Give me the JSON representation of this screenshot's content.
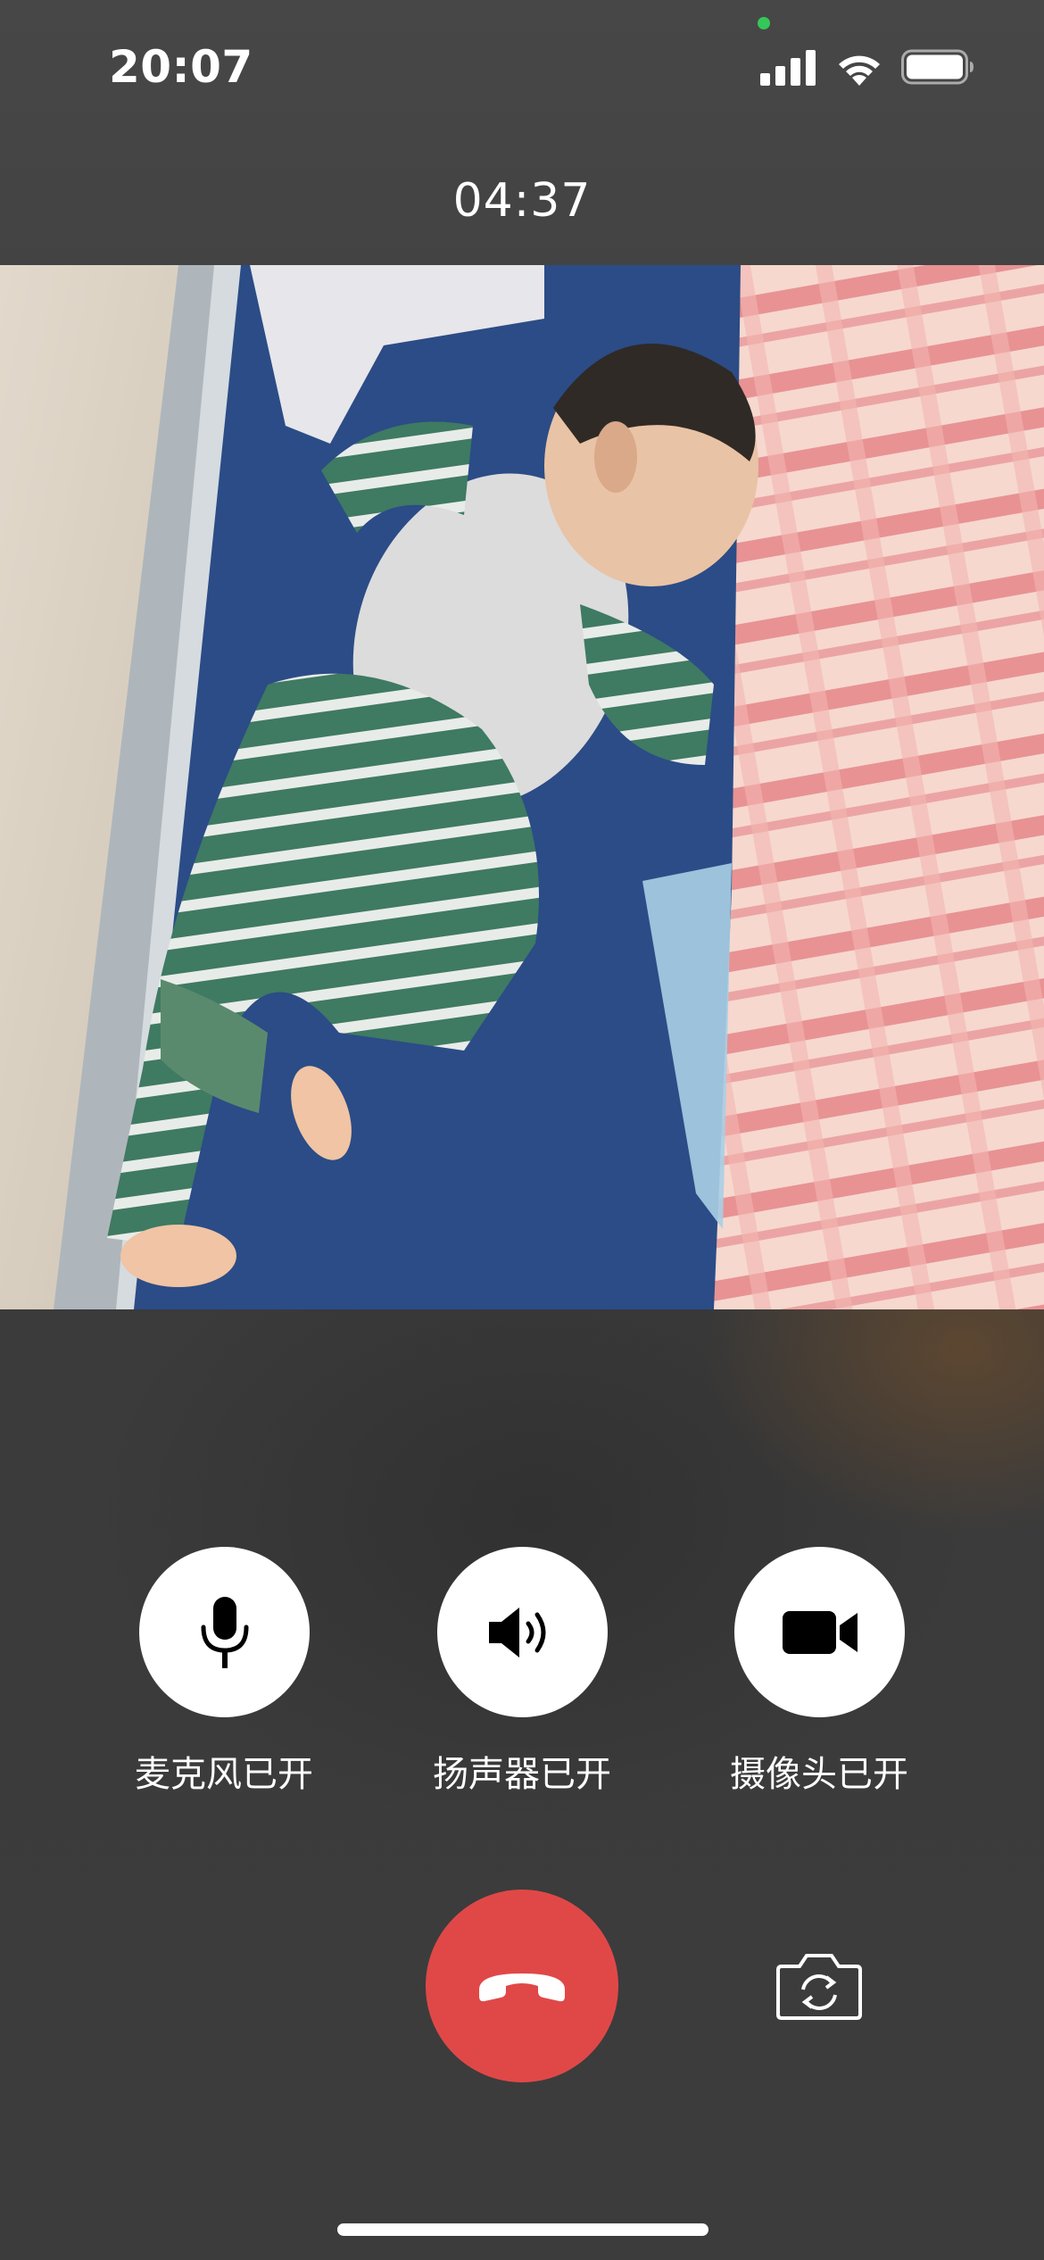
{
  "status_bar": {
    "time": "20:07",
    "icons": [
      "signal-icon",
      "wifi-icon",
      "battery-icon"
    ],
    "privacy_indicator_color": "#34c759"
  },
  "call": {
    "timer": "04:37",
    "video_feed": "remote-video"
  },
  "controls": {
    "microphone": {
      "label": "麦克风已开",
      "icon": "microphone-icon"
    },
    "speaker": {
      "label": "扬声器已开",
      "icon": "speaker-icon"
    },
    "camera": {
      "label": "摄像头已开",
      "icon": "video-camera-icon"
    }
  },
  "bottom": {
    "end_call_icon": "phone-hangup-icon",
    "end_call_color": "#e04848",
    "flip_camera_icon": "camera-flip-icon"
  }
}
